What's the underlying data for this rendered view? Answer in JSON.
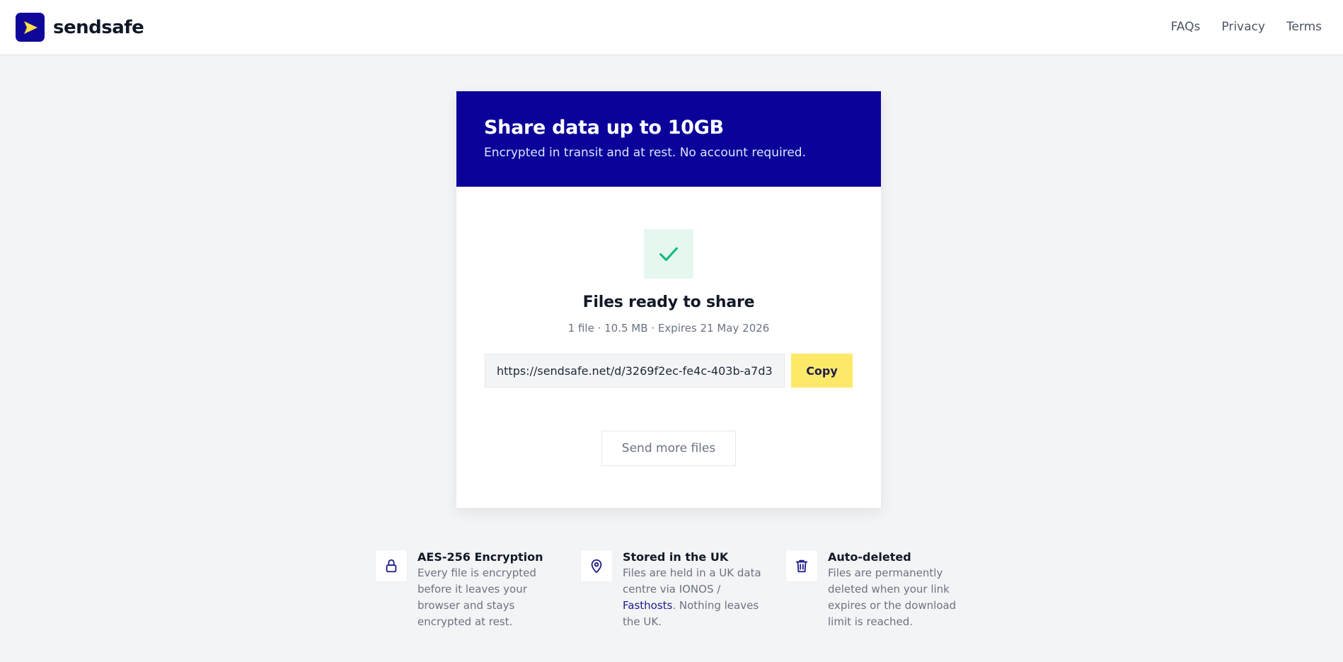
{
  "header": {
    "brand_name": "sendsafe",
    "nav": [
      "FAQs",
      "Privacy",
      "Terms"
    ]
  },
  "card": {
    "title": "Share data up to 10GB",
    "subtitle": "Encrypted in transit and at rest. No account required.",
    "ready_title": "Files ready to share",
    "ready_meta": "1 file · 10.5 MB · Expires 21 May 2026",
    "share_link": "https://sendsafe.net/d/3269f2ec-fe4c-403b-a7d3-",
    "copy_label": "Copy",
    "send_more_label": "Send more files"
  },
  "features": [
    {
      "icon": "lock-icon",
      "title": "AES-256 Encryption",
      "desc": "Every file is encrypted before it leaves your browser and stays encrypted at rest."
    },
    {
      "icon": "map-pin-icon",
      "title": "Stored in the UK",
      "desc_before": "Files are held in a UK data centre via IONOS / ",
      "desc_link": "Fasthosts",
      "desc_after": ". Nothing leaves the UK."
    },
    {
      "icon": "trash-icon",
      "title": "Auto-deleted",
      "desc": "Files are permanently deleted when your link expires or the download limit is reached."
    }
  ],
  "colors": {
    "brand": "#0b0399",
    "accent": "#fde968",
    "success": "#10b981",
    "success_bg": "#e6f7f0"
  }
}
